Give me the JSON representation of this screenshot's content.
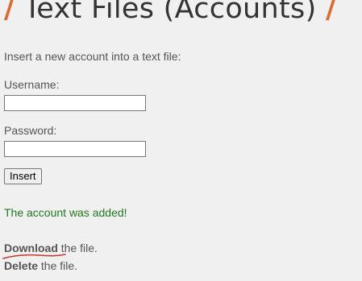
{
  "header": {
    "slash_left": "/",
    "title": "Text Files (Accounts)",
    "slash_right": "/",
    "slash_color": "#e06a2b"
  },
  "form": {
    "intro": "Insert a new account into a text file:",
    "username_label": "Username:",
    "username_value": "",
    "password_label": "Password:",
    "password_value": "",
    "insert_label": "Insert"
  },
  "status": {
    "message": "The account was added!",
    "color": "#1f7a1f"
  },
  "actions": {
    "download_link": "Download",
    "download_suffix": " the file.",
    "delete_link": "Delete",
    "delete_suffix": " the file."
  }
}
